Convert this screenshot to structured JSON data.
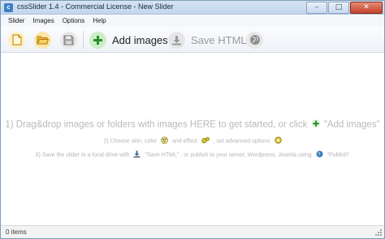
{
  "window": {
    "title": "cssSlider 1.4 - Commercial License - New Slider",
    "minimize_glyph": "–",
    "maximize_glyph": "□",
    "close_glyph": "✕"
  },
  "menu": {
    "items": [
      "Slider",
      "Images",
      "Options",
      "Help"
    ]
  },
  "toolbar": {
    "add_images_label": "Add images",
    "save_html_label": "Save HTML"
  },
  "instructions": {
    "line1_text": "1) Drag&drop images or folders with images HERE to get started, or click",
    "line1_button": "\"Add images\"",
    "line2_a": "2) Choose skin, color",
    "line2_b": "and effect",
    "line2_c": ", set advanced options",
    "line3_a": "3) Save the slider to a local drive with",
    "line3_b": "\"Save HTML\" , or publish to your server, Wordpress, Joomla using",
    "line3_c": "\"Publish\""
  },
  "status": {
    "items_count": "0 items"
  },
  "colors": {
    "add_green": "#2e8b2e",
    "disabled_gray": "#9a9a9a",
    "hint_gray": "#b9b9b9",
    "titlebar": "#c3d6ee"
  },
  "icons": {
    "new": "new-document-icon",
    "open": "open-folder-icon",
    "save": "save-disk-icon",
    "add": "plus-icon",
    "save_html": "download-icon",
    "publish": "globe-icon"
  }
}
